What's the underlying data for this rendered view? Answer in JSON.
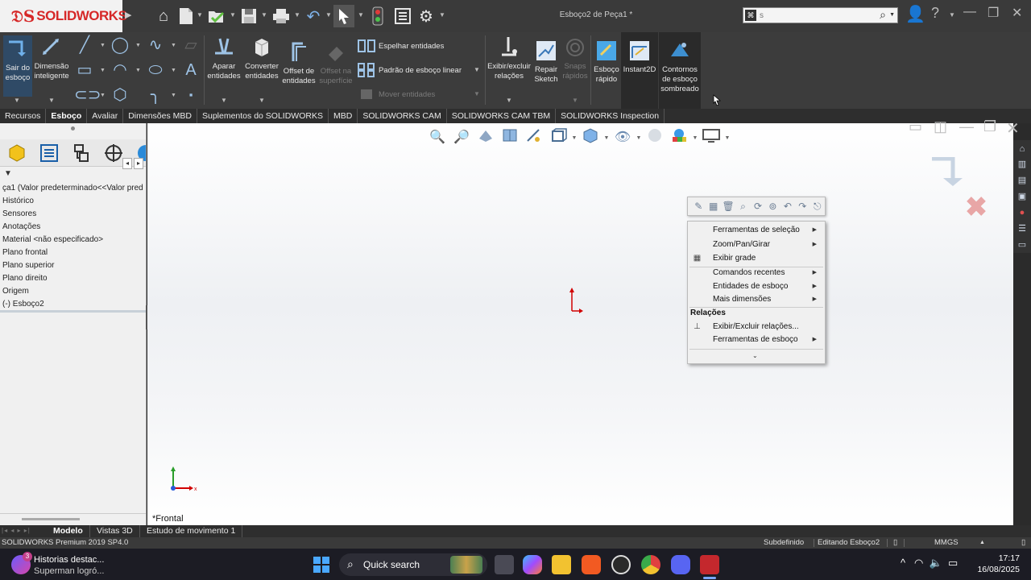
{
  "window": {
    "logo_text": "SOLIDWORKS",
    "doc_title": "Esboço2 de Peça1 *",
    "search_placeholder": "s"
  },
  "ribbon": {
    "sair_esboco": "Sair do esboço",
    "dimensao_inteligente": "Dimensão inteligente",
    "aparar": "Aparar entidades",
    "converter": "Converter entidades",
    "offset_entidades": "Offset de entidades",
    "offset_superficie": "Offset na superfície",
    "espelhar": "Espelhar entidades",
    "padrao_linear": "Padrão de esboço linear",
    "mover": "Mover entidades",
    "exibir_excluir": "Exibir/excluir relações",
    "repair_sketch": "Repair Sketch",
    "snaps_rapidos": "Snaps rápidos",
    "esboco_rapido": "Esboço rápido",
    "instant2d": "Instant2D",
    "contornos": "Contornos de esboço sombreado"
  },
  "command_tabs": [
    {
      "label": "Recursos",
      "active": false
    },
    {
      "label": "Esboço",
      "active": true
    },
    {
      "label": "Avaliar",
      "active": false
    },
    {
      "label": "Dimensões MBD",
      "active": false
    },
    {
      "label": "Suplementos do SOLIDWORKS",
      "active": false
    },
    {
      "label": "MBD",
      "active": false
    },
    {
      "label": "SOLIDWORKS CAM",
      "active": false
    },
    {
      "label": "SOLIDWORKS CAM TBM",
      "active": false
    },
    {
      "label": "SOLIDWORKS Inspection",
      "active": false
    }
  ],
  "tree": {
    "items": [
      "ça1  (Valor predeterminado<<Valor pred",
      "Histórico",
      "Sensores",
      "Anotações",
      "Material <não especificado>",
      "Plano frontal",
      "Plano superior",
      "Plano direito",
      "Origem",
      "(-) Esboço2"
    ]
  },
  "graphics": {
    "view_label": "*Frontal"
  },
  "context_menu": {
    "items": [
      {
        "label": "Ferramentas de seleção",
        "submenu": true
      },
      {
        "label": "Zoom/Pan/Girar",
        "submenu": true
      },
      {
        "label": "Exibir grade",
        "submenu": false
      },
      {
        "label": "Comandos recentes",
        "submenu": true
      },
      {
        "label": "Entidades de esboço",
        "submenu": true
      },
      {
        "label": "Mais dimensões",
        "submenu": true
      }
    ],
    "section_header": "Relações",
    "relation_items": [
      {
        "label": "Exibir/Excluir relações...",
        "submenu": false
      },
      {
        "label": "Ferramentas de esboço",
        "submenu": true
      }
    ]
  },
  "bottom_tabs": [
    {
      "label": "Modelo",
      "active": true
    },
    {
      "label": "Vistas 3D",
      "active": false
    },
    {
      "label": "Estudo de movimento 1",
      "active": false
    }
  ],
  "status": {
    "product": "SOLIDWORKS Premium 2019 SP4.0",
    "state": "Subdefinido",
    "editing": "Editando Esboço2",
    "units": "MMGS"
  },
  "taskbar": {
    "news_title": "Historias destac...",
    "news_sub": "Superman logró...",
    "news_badge": "3",
    "search_label": "Quick search",
    "time": "17:17",
    "date": "16/08/2025"
  },
  "colors": {
    "accent_blue": "#3aa0e6",
    "logo_red": "#d62828",
    "origin_red": "#d10000"
  }
}
